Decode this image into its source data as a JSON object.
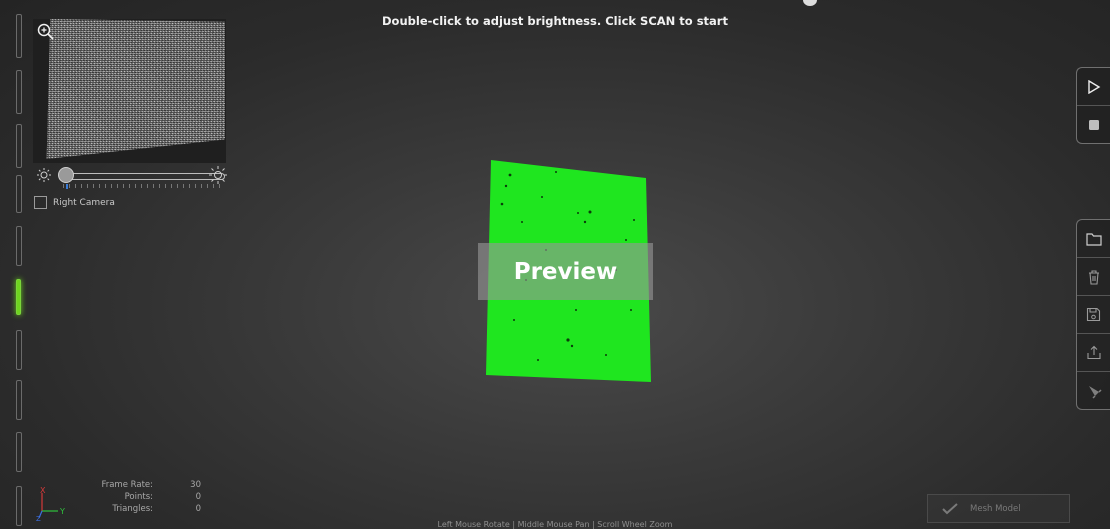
{
  "header": {
    "message": "Double-click to adjust brightness. Click SCAN to start"
  },
  "camera": {
    "zoom_icon": "zoom-in-icon",
    "right_camera_label": "Right Camera",
    "right_camera_checked": false,
    "brightness_level": 0.02
  },
  "scan_view": {
    "preview_label": "Preview",
    "scan_color": "#1fe61f"
  },
  "stats": {
    "frame_rate_label": "Frame Rate:",
    "frame_rate": "30",
    "points_label": "Points:",
    "points": "0",
    "triangles_label": "Triangles:",
    "triangles": "0"
  },
  "axis": {
    "x": "X",
    "y": "Y",
    "z": "Z"
  },
  "toolbar_top": [
    "play-icon",
    "stop-icon"
  ],
  "toolbar_files": [
    "folder-icon",
    "trash-icon",
    "save-icon",
    "export-icon",
    "brush-icon"
  ],
  "mesh_button": {
    "label": "Mesh Model"
  },
  "footer": {
    "hint": "Left Mouse Rotate | Middle Mouse Pan | Scroll Wheel Zoom"
  },
  "colors": {
    "accent_green": "#6fd51f",
    "scan_green": "#1fe61f"
  }
}
